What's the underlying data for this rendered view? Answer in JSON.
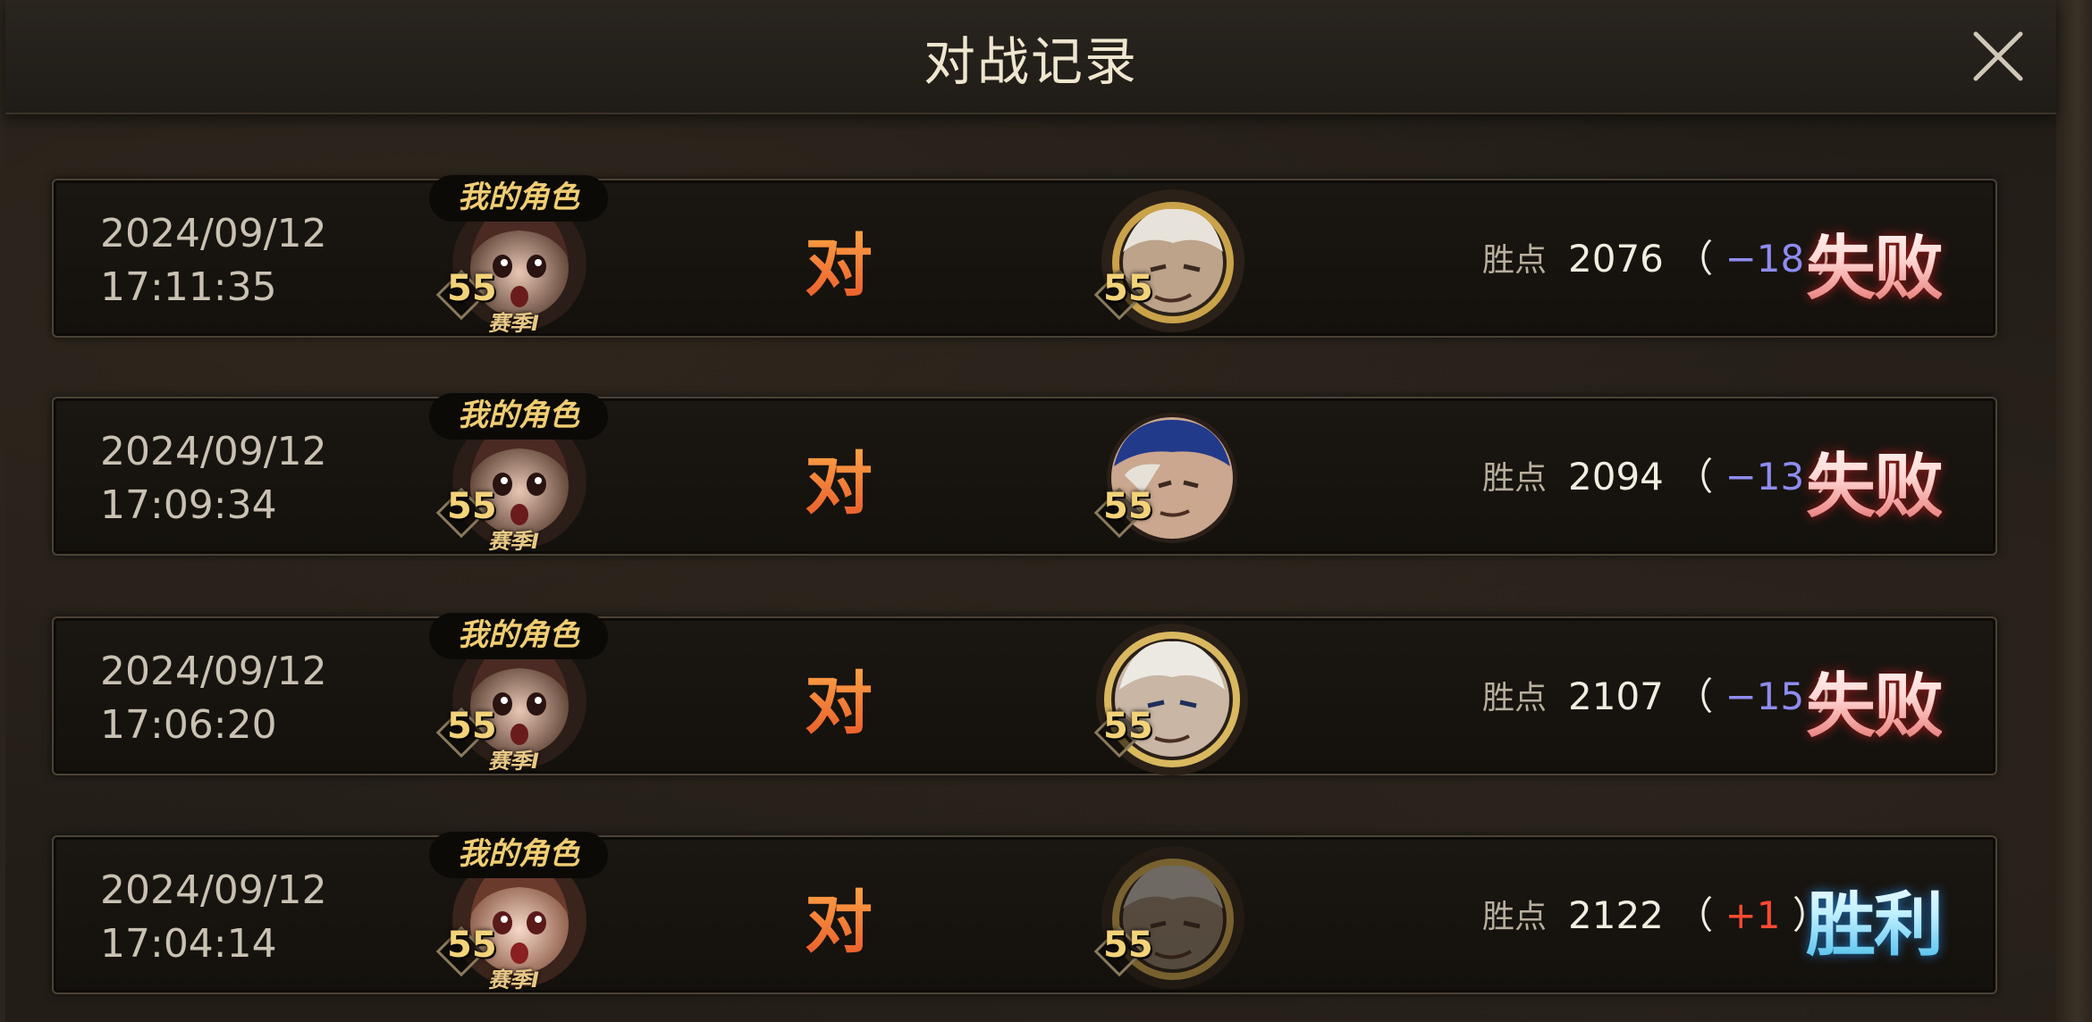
{
  "dialog": {
    "title": "对战记录",
    "close_icon": "close-icon"
  },
  "labels": {
    "mine": "我的角色",
    "vs": "对",
    "points": "胜点",
    "season": "赛季Ⅰ"
  },
  "records": [
    {
      "date": "2024/09/12",
      "time": "17:11:35",
      "my_level": "55",
      "opp_level": "55",
      "points": "2076",
      "delta": "−18",
      "delta_sign": "neg",
      "result": "失败",
      "result_type": "lose"
    },
    {
      "date": "2024/09/12",
      "time": "17:09:34",
      "my_level": "55",
      "opp_level": "55",
      "points": "2094",
      "delta": "−13",
      "delta_sign": "neg",
      "result": "失败",
      "result_type": "lose"
    },
    {
      "date": "2024/09/12",
      "time": "17:06:20",
      "my_level": "55",
      "opp_level": "55",
      "points": "2107",
      "delta": "−15",
      "delta_sign": "neg",
      "result": "失败",
      "result_type": "lose"
    },
    {
      "date": "2024/09/12",
      "time": "17:04:14",
      "my_level": "55",
      "opp_level": "55",
      "points": "2122",
      "delta": "+1",
      "delta_sign": "pos",
      "result": "胜利",
      "result_type": "win"
    }
  ],
  "colors": {
    "negative_delta": "#8e8cf0",
    "positive_delta": "#ff4a32",
    "lose": "#e26a67",
    "win": "#3fb8ea"
  }
}
